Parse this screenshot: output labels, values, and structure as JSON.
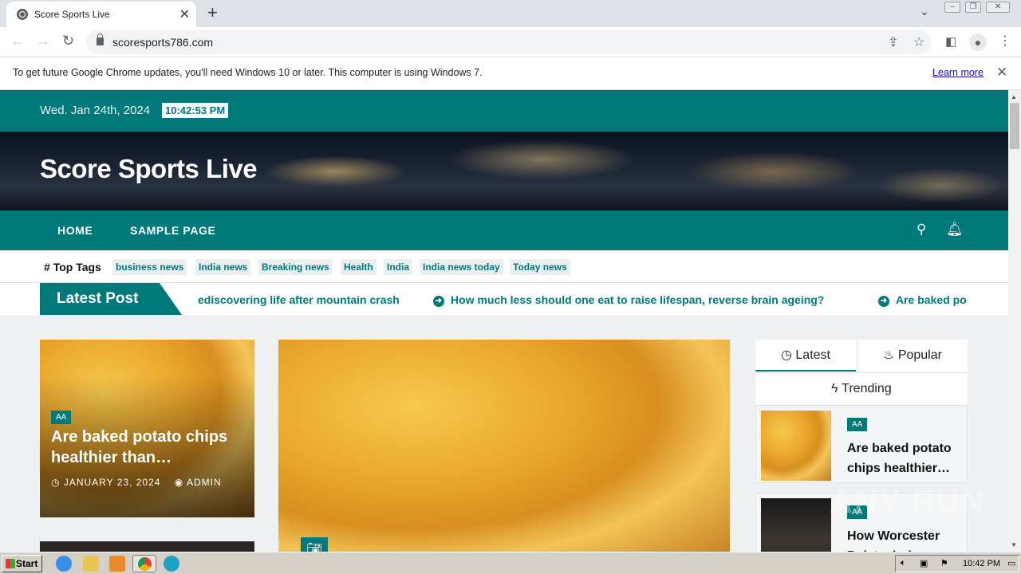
{
  "browser": {
    "tab_title": "Score Sports Live",
    "url": "scoresports786.com",
    "infobar_message": "To get future Google Chrome updates, you'll need Windows 10 or later. This computer is using Windows 7.",
    "infobar_link": "Learn more"
  },
  "page": {
    "date": "Wed. Jan 24th, 2024",
    "time": "10:42:53 PM",
    "site_title": "Score Sports Live",
    "nav": [
      "HOME",
      "SAMPLE PAGE"
    ],
    "top_tags_label": "Top Tags",
    "tags": [
      "business news",
      "India news",
      "Breaking news",
      "Health",
      "India",
      "India news today",
      "Today news"
    ],
    "latest_post_label": "Latest Post",
    "ticker": [
      "ediscovering life after mountain crash",
      "How much less should one eat to raise lifespan, reverse brain ageing?",
      "Are baked po"
    ],
    "card1": {
      "category": "AA",
      "title": "Are baked potato chips healthier than…",
      "date": "JANUARY 23, 2024",
      "author": "ADMIN"
    },
    "sidebar": {
      "tabs": [
        "Latest",
        "Popular",
        "Trending"
      ],
      "items": [
        {
          "category": "AA",
          "title": "Are baked potato chips healthier…"
        },
        {
          "category": "AA",
          "title": "How Worcester Polytechnic"
        }
      ]
    }
  },
  "taskbar": {
    "start_label": "Start",
    "clock": "10:42 PM"
  },
  "watermark": "ANY RUN"
}
